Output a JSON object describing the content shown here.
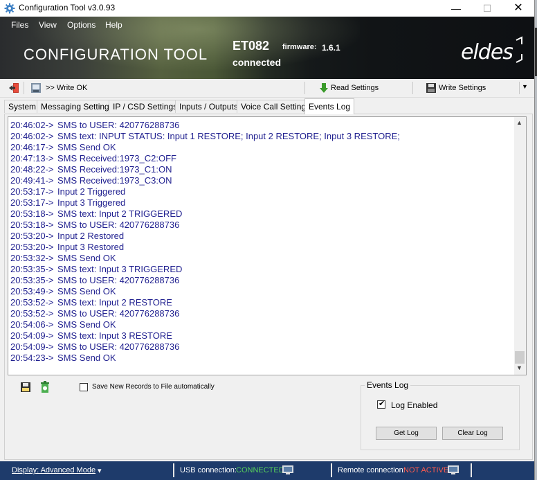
{
  "window": {
    "title": "Configuration Tool v3.0.93",
    "minimize": "—",
    "maximize": "☐",
    "close": "✕"
  },
  "menu": [
    "Files",
    "View",
    "Options",
    "Help"
  ],
  "banner": {
    "title": "CONFIGURATION TOOL",
    "device_model": "ET082",
    "firmware_label": "firmware:",
    "firmware_version": "1.6.1",
    "connection": "connected",
    "logo": "eldes"
  },
  "toolbar": {
    "status_text": ">> Write OK",
    "read_label": "Read Settings",
    "write_label": "Write Settings",
    "dropdown": "▼"
  },
  "tabs": [
    "System",
    "Messaging Settings",
    "IP / CSD Settings",
    "Inputs / Outputs",
    "Voice Call Settings",
    "Events Log"
  ],
  "active_tab": "Events Log",
  "log": [
    {
      "time": "20:46:02->",
      "msg": "SMS to USER: 420776288736"
    },
    {
      "time": "20:46:02->",
      "msg": "SMS text: INPUT STATUS: Input 1 RESTORE; Input 2 RESTORE; Input 3 RESTORE;"
    },
    {
      "time": "20:46:17->",
      "msg": "SMS Send OK"
    },
    {
      "time": "20:47:13->",
      "msg": "SMS Received:1973_C2:OFF"
    },
    {
      "time": "20:48:22->",
      "msg": "SMS Received:1973_C1:ON"
    },
    {
      "time": "20:49:41->",
      "msg": "SMS Received:1973_C3:ON"
    },
    {
      "time": "20:53:17->",
      "msg": "Input 2 Triggered"
    },
    {
      "time": "20:53:17->",
      "msg": "Input 3 Triggered"
    },
    {
      "time": "20:53:18->",
      "msg": "SMS text: Input 2 TRIGGERED"
    },
    {
      "time": "20:53:18->",
      "msg": "SMS to USER: 420776288736"
    },
    {
      "time": "20:53:20->",
      "msg": "Input 2 Restored"
    },
    {
      "time": "20:53:20->",
      "msg": "Input 3 Restored"
    },
    {
      "time": "20:53:32->",
      "msg": "SMS Send OK"
    },
    {
      "time": "20:53:35->",
      "msg": "SMS text: Input 3 TRIGGERED"
    },
    {
      "time": "20:53:35->",
      "msg": "SMS to USER: 420776288736"
    },
    {
      "time": "20:53:49->",
      "msg": "SMS Send OK"
    },
    {
      "time": "20:53:52->",
      "msg": "SMS text: Input 2 RESTORE"
    },
    {
      "time": "20:53:52->",
      "msg": "SMS to USER: 420776288736"
    },
    {
      "time": "20:54:06->",
      "msg": "SMS Send OK"
    },
    {
      "time": "20:54:09->",
      "msg": "SMS text: Input 3 RESTORE"
    },
    {
      "time": "20:54:09->",
      "msg": "SMS to USER: 420776288736"
    },
    {
      "time": "20:54:23->",
      "msg": "SMS Send OK"
    }
  ],
  "controls": {
    "autosave_label": "Save New Records to File automatically",
    "autosave_checked": false,
    "group_title": "Events Log",
    "log_enabled_label": "Log Enabled",
    "log_enabled_checked": true,
    "check_mark": "✔",
    "get_log": "Get Log",
    "clear_log": "Clear Log"
  },
  "statusbar": {
    "display_mode": "Display: Advanced Mode",
    "display_arrow": "▾",
    "usb_label": "USB connection:",
    "usb_value": "CONNECTED",
    "remote_label": "Remote connection:",
    "remote_value": "NOT ACTIVE"
  },
  "colors": {
    "log_text": "#1f1f8f",
    "status_bar": "#1e3b6b",
    "connected": "#57d15b",
    "not_active": "#ff5b4d"
  },
  "icons": [
    "gear-icon",
    "exit-icon",
    "device-icon",
    "download-arrow-icon",
    "floppy-disk-icon",
    "save-log-icon",
    "trash-icon",
    "monitor-icon"
  ]
}
